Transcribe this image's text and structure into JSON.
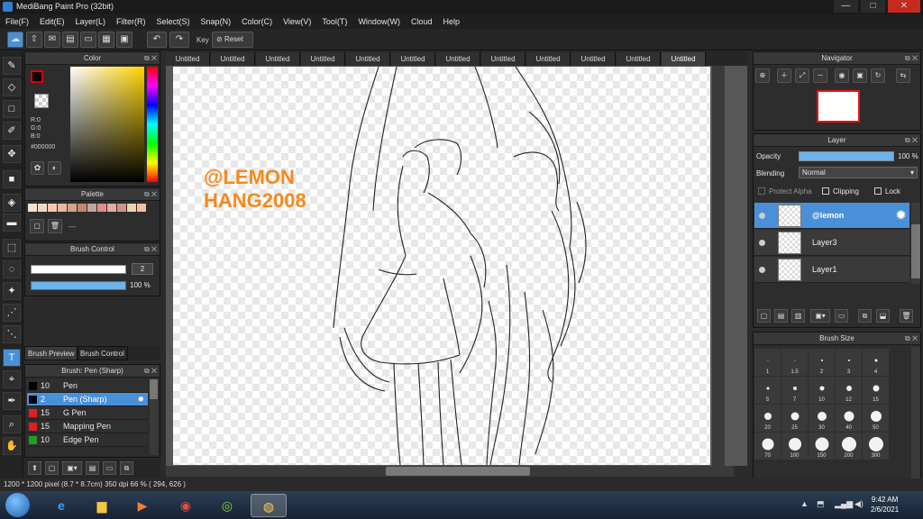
{
  "window": {
    "title": "MediBang Paint Pro (32bit)",
    "min": "—",
    "max": "□",
    "close": "✕"
  },
  "menu": [
    "File(F)",
    "Edit(E)",
    "Layer(L)",
    "Filter(R)",
    "Select(S)",
    "Snap(N)",
    "Color(C)",
    "View(V)",
    "Tool(T)",
    "Window(W)",
    "Cloud",
    "Help"
  ],
  "toolbar": {
    "key_label": "Key",
    "reset_label": "Reset",
    "undo": "↶",
    "redo": "↷"
  },
  "color_panel": {
    "title": "Color",
    "r": "R:0",
    "g": "G:0",
    "b": "B:0",
    "hex": "#000000"
  },
  "palette_panel": {
    "title": "Palette",
    "swatches": [
      "#f5e1cf",
      "#eedac4",
      "#f2c9b6",
      "#e8b9a4",
      "#d5a28f",
      "#c58673",
      "#bda7a0",
      "#dd8d93",
      "#ecaaa1",
      "#cf9580",
      "#ecd3b0",
      "#f1c19c"
    ],
    "dash": "---"
  },
  "brush_control": {
    "title": "Brush Control",
    "size": "2",
    "opacity": "100 %",
    "opacity_fill": 1.0
  },
  "preview_tabs": {
    "preview": "Brush Preview",
    "control": "Brush Control"
  },
  "brush_list": {
    "title": "Brush: Pen (Sharp)",
    "items": [
      {
        "size": "10",
        "name": "Pen",
        "color": "#000000"
      },
      {
        "size": "2",
        "name": "Pen (Sharp)",
        "color": "#000000",
        "selected": true
      },
      {
        "size": "15",
        "name": "G Pen",
        "color": "#e02020"
      },
      {
        "size": "15",
        "name": "Mapping Pen",
        "color": "#e02020"
      },
      {
        "size": "10",
        "name": "Edge Pen",
        "color": "#20a020"
      }
    ]
  },
  "doc_tabs": [
    "Untitled",
    "Untitled",
    "Untitled",
    "Untitled",
    "Untitled",
    "Untitled",
    "Untitled",
    "Untitled",
    "Untitled",
    "Untitled",
    "Untitled",
    "Untitled"
  ],
  "watermark": {
    "line1": "@LEMON",
    "line2": "HANG2008"
  },
  "navigator": {
    "title": "Navigator"
  },
  "layer_panel": {
    "title": "Layer",
    "opacity_label": "Opacity",
    "opacity_value": "100 %",
    "blending_label": "Blending",
    "blending_value": "Normal",
    "protect_alpha": "Protect Alpha",
    "clipping": "Clipping",
    "lock": "Lock",
    "layers": [
      {
        "name": "@lemon",
        "selected": true
      },
      {
        "name": "Layer3"
      },
      {
        "name": "Layer1"
      }
    ]
  },
  "brush_size": {
    "title": "Brush Size",
    "values": [
      "1",
      "1.5",
      "2",
      "3",
      "4",
      "5",
      "7",
      "10",
      "12",
      "15",
      "20",
      "25",
      "30",
      "40",
      "50",
      "70",
      "100",
      "150",
      "200",
      "300"
    ]
  },
  "status": {
    "text": "1200 * 1200 pixel  (8.7 * 8.7cm)  350 dpi  66 %  ( 294, 626 )"
  },
  "clock": {
    "time": "9:42 AM",
    "date": "2/6/2021"
  }
}
